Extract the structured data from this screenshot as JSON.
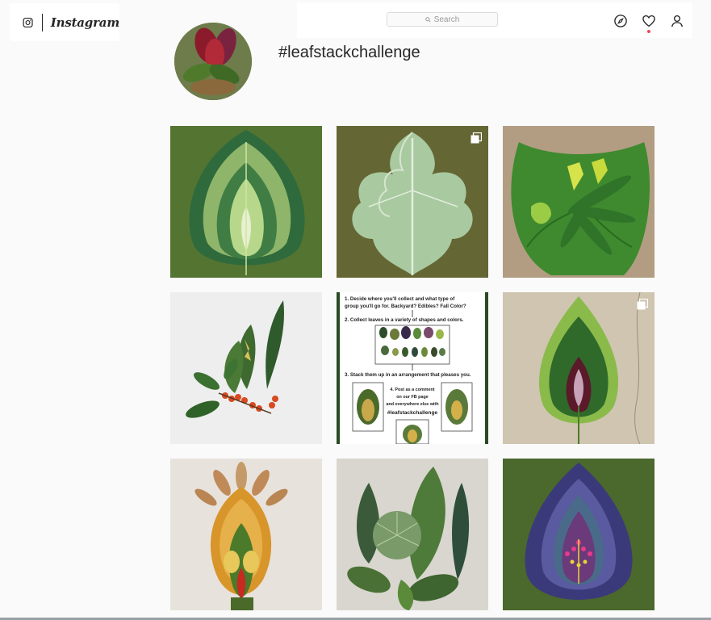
{
  "app": {
    "wordmark": "Instagram"
  },
  "search": {
    "placeholder": "Search"
  },
  "profile": {
    "hashtag": "#leafstackchallenge"
  },
  "poster": {
    "step1": "1. Decide where you'll collect and what type of",
    "step1b": "group you'll go for. Backyard? Edibles? Fall Color?",
    "step2": "2. Collect leaves in a variety of shapes and colors.",
    "step3": "3. Stack them up in an arrangement that pleases you.",
    "step4a": "4. Post as a comment",
    "step4b": "on our FB page",
    "step4c": "and everywhere else with",
    "step4d": "#leafstackchallenge"
  },
  "colors": {
    "accent": "#ed4956",
    "text": "#262626"
  },
  "icons": [
    "instagram-icon",
    "search-icon",
    "compass-icon",
    "heart-icon",
    "user-icon",
    "multi-post-icon"
  ]
}
